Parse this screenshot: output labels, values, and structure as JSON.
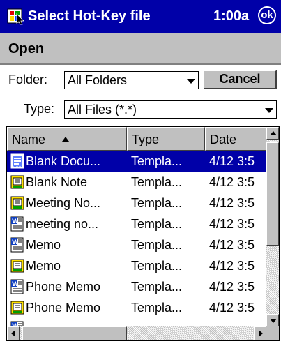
{
  "titlebar": {
    "title": "Select Hot-Key file",
    "clock": "1:00a",
    "ok_label": "ok"
  },
  "command_bar": {
    "open_label": "Open"
  },
  "filter": {
    "folder_label": "Folder:",
    "folder_value": "All Folders",
    "cancel_label": "Cancel",
    "type_label": "Type:",
    "type_value": "All Files (*.*)"
  },
  "list": {
    "columns": [
      {
        "label": "Name"
      },
      {
        "label": "Type"
      },
      {
        "label": "Date"
      }
    ],
    "rows": [
      {
        "icon": "template-icon",
        "name": "Blank Docu...",
        "type": "Templa...",
        "date": "4/12 3:5",
        "selected": true
      },
      {
        "icon": "note-icon",
        "name": "Blank Note",
        "type": "Templa...",
        "date": "4/12 3:5"
      },
      {
        "icon": "note-icon",
        "name": "Meeting No...",
        "type": "Templa...",
        "date": "4/12 3:5"
      },
      {
        "icon": "word-icon",
        "name": "meeting no...",
        "type": "Templa...",
        "date": "4/12 3:5"
      },
      {
        "icon": "word-icon",
        "name": "Memo",
        "type": "Templa...",
        "date": "4/12 3:5"
      },
      {
        "icon": "note-icon",
        "name": "Memo",
        "type": "Templa...",
        "date": "4/12 3:5"
      },
      {
        "icon": "word-icon",
        "name": "Phone Memo",
        "type": "Templa...",
        "date": "4/12 3:5"
      },
      {
        "icon": "note-icon",
        "name": "Phone Memo",
        "type": "Templa...",
        "date": "4/12 3:5"
      }
    ]
  },
  "colors": {
    "titlebar": "#0000a8",
    "selection": "#0000a8",
    "chrome": "#c0c0c0"
  }
}
